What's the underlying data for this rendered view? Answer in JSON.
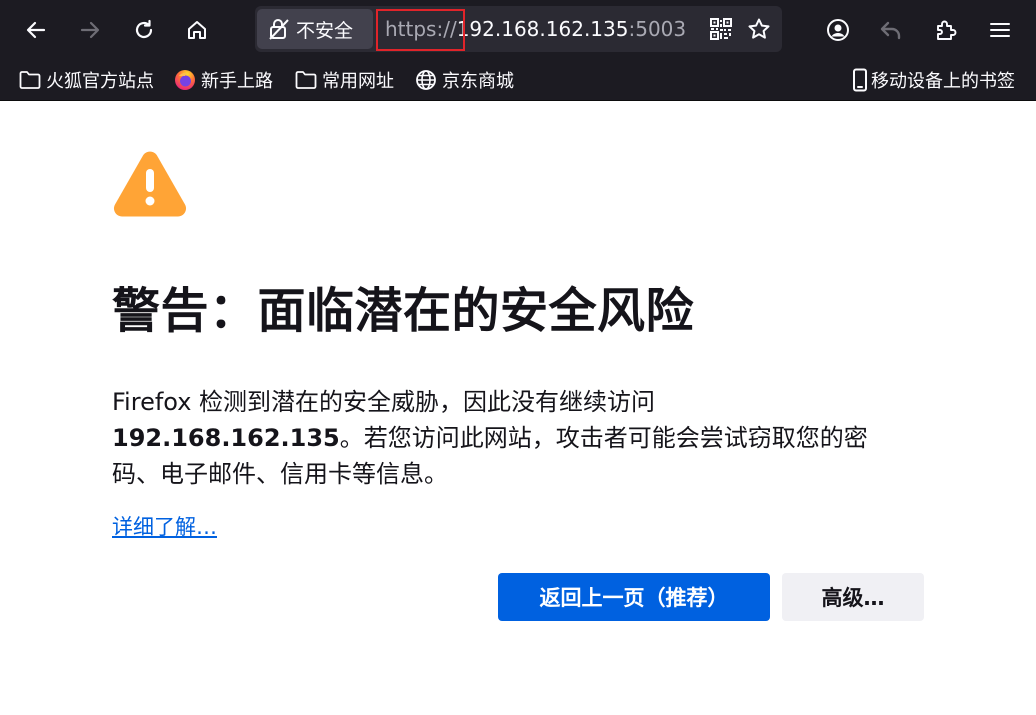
{
  "toolbar": {
    "back_icon": "arrow-left-icon",
    "forward_icon": "arrow-right-icon",
    "reload_icon": "reload-icon",
    "home_icon": "home-icon",
    "site_info_label": "不安全",
    "url_scheme": "https://",
    "url_host": "192.168.162.135",
    "url_port": ":5003",
    "highlight_color": "#e0242a",
    "account_icon": "account-icon",
    "undo_icon": "undo-icon",
    "extensions_icon": "extensions-icon",
    "menu_icon": "hamburger-menu-icon"
  },
  "bookmarks": {
    "items": [
      {
        "label": "火狐官方站点",
        "icon": "folder-icon"
      },
      {
        "label": "新手上路",
        "icon": "firefox-icon"
      },
      {
        "label": "常用网址",
        "icon": "folder-icon"
      },
      {
        "label": "京东商城",
        "icon": "globe-icon"
      }
    ],
    "mobile_label": "移动设备上的书签"
  },
  "content": {
    "title": "警告：面临潜在的安全风险",
    "desc_part1": "Firefox 检测到潜在的安全威胁，因此没有继续访问",
    "desc_host": "192.168.162.135",
    "desc_part2": "。若您访问此网站，攻击者可能会尝试窃取您的密码、电子邮件、信用卡等信息。",
    "learn_more": "详细了解…",
    "go_back_button": "返回上一页（推荐）",
    "advanced_button": "高级…",
    "warning_color": "#ffa436",
    "primary_color": "#0061e0"
  }
}
